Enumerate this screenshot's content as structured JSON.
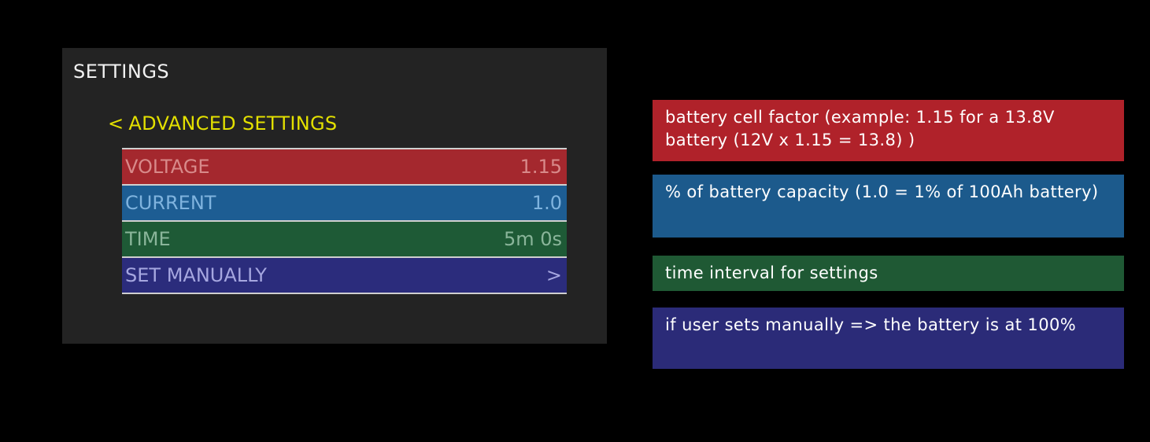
{
  "panel": {
    "title": "SETTINGS",
    "back": {
      "icon": "chevron-left-icon",
      "chevron": "<",
      "label": "ADVANCED SETTINGS",
      "color": "#e3e000"
    },
    "rows": [
      {
        "label": "VOLTAGE",
        "value": "1.15",
        "color": "#a4282e"
      },
      {
        "label": "CURRENT",
        "value": "1.0",
        "color": "#1d5d93"
      },
      {
        "label": "TIME",
        "value": "5m 0s",
        "color": "#1e5a36"
      },
      {
        "label": "SET MANUALLY",
        "value": ">",
        "icon": "chevron-right-icon",
        "color": "#2b2c7c"
      }
    ]
  },
  "notes": [
    {
      "text": "battery cell factor (example: 1.15 for a 13.8V battery (12V x 1.15 = 13.8) )",
      "color": "#b0222a"
    },
    {
      "text": "% of battery capacity (1.0 = 1% of 100Ah battery)",
      "color": "#1c5a8c"
    },
    {
      "text": "time interval for settings",
      "color": "#1f5934"
    },
    {
      "text": "if user sets manually => the battery is at 100%",
      "color": "#2b2b78"
    }
  ]
}
